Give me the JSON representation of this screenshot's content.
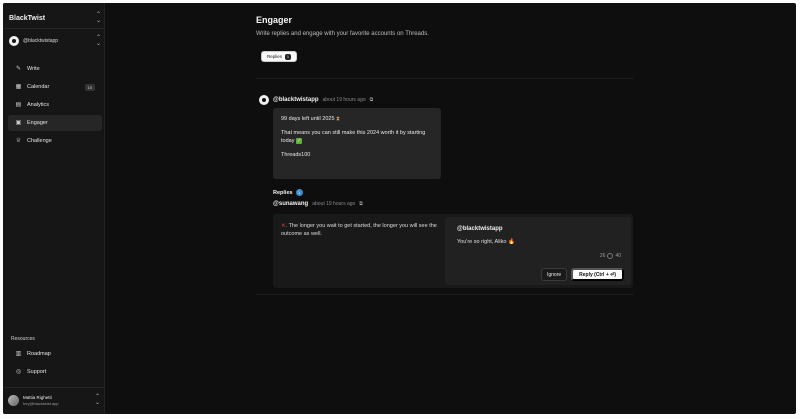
{
  "sidebar": {
    "workspace": "BlackTwist",
    "account": "@blacktwistapp",
    "nav": [
      {
        "label": "Write",
        "icon": "pen-icon"
      },
      {
        "label": "Calendar",
        "icon": "calendar-icon",
        "badge": "10"
      },
      {
        "label": "Analytics",
        "icon": "analytics-icon"
      },
      {
        "label": "Engager",
        "icon": "engager-icon",
        "active": true
      },
      {
        "label": "Challenge",
        "icon": "trophy-icon"
      }
    ],
    "resources_label": "Resources",
    "resources": [
      {
        "label": "Roadmap",
        "icon": "map-icon"
      },
      {
        "label": "Support",
        "icon": "support-icon"
      }
    ],
    "user": {
      "name": "Mattia Righetti",
      "email": "hey@blacktwist.app"
    }
  },
  "main": {
    "title": "Engager",
    "subtitle": "Write replies and engage with your favorite accounts on Threads.",
    "tab": {
      "label": "Replies",
      "count": "1"
    },
    "post": {
      "author": "@blacktwistapp",
      "time": "about 19 hours ago",
      "line1": "99 days left until 2025",
      "line2": "That means you can still make this 2024 worth it by starting today",
      "line3": "Threads100"
    },
    "replies": {
      "label": "Replies",
      "count": "1"
    },
    "reply": {
      "author": "@sunawang",
      "time": "about 19 hours ago",
      "text": ". The longer you wait to get started, the longer you will see the outcome as well."
    },
    "draft": {
      "author": "@blacktwistapp",
      "text": "You're so right, Aliko",
      "count_current": "26",
      "count_max": "40",
      "ignore_label": "Ignore",
      "reply_label": "Reply (Ctrl + ⏎)"
    }
  }
}
